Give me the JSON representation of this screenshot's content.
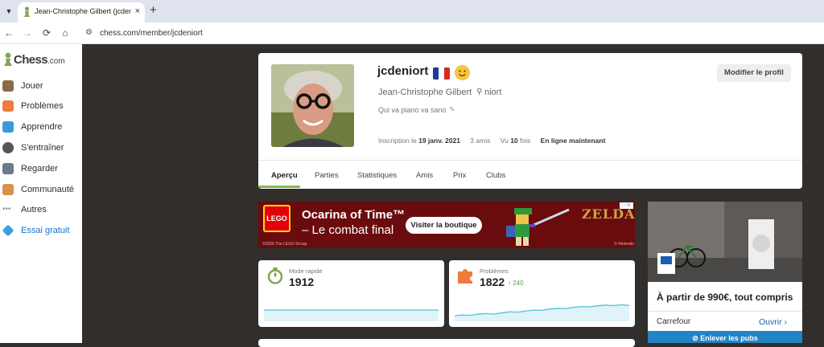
{
  "browser": {
    "tab_title": "Jean-Christophe Gilbert (jcdeniort)",
    "tab_close": "×",
    "new_tab": "+",
    "tab_list_icon": "chevron-down-icon",
    "url": "chess.com/member/jcdeniort",
    "nav": {
      "back": "←",
      "forward": "→",
      "reload": "⟳",
      "home": "⌂"
    }
  },
  "sidebar": {
    "logo_text": "Chess",
    "logo_suffix": ".com",
    "items": [
      {
        "label": "Jouer",
        "icon": "play-pieces-icon",
        "color": "#8a6a4a"
      },
      {
        "label": "Problèmes",
        "icon": "puzzle-icon",
        "color": "#f07b3f"
      },
      {
        "label": "Apprendre",
        "icon": "graduation-cap-icon",
        "color": "#3a9ad9"
      },
      {
        "label": "S'entraîner",
        "icon": "practice-icon",
        "color": "#555555"
      },
      {
        "label": "Regarder",
        "icon": "binoculars-icon",
        "color": "#6c7a8a"
      },
      {
        "label": "Communauté",
        "icon": "community-icon",
        "color": "#d9914a"
      },
      {
        "label": "Autres",
        "icon": "more-dots-icon",
        "color": "#999999"
      },
      {
        "label": "Essai gratuit",
        "icon": "diamond-icon",
        "color": "#36a3e0"
      }
    ]
  },
  "profile": {
    "username": "jcdeniort",
    "full_name": "Jean-Christophe Gilbert",
    "location": "niort",
    "bio": "Qui va piano va sano",
    "joined_label": "Inscription le",
    "joined_date": "19 janv. 2021",
    "friends_count": "3",
    "friends_label": "amis",
    "views_prefix": "Vu",
    "views_count": "10",
    "views_suffix": "fois",
    "online_status": "En ligne maintenant",
    "edit_button": "Modifier le profil",
    "tabs": [
      "Aperçu",
      "Parties",
      "Statistiques",
      "Amis",
      "Prix",
      "Clubs"
    ],
    "active_tab": "Aperçu"
  },
  "ad_banner": {
    "brand": "LEGO",
    "title": "Ocarina of Time™",
    "subtitle": "– Le combat final",
    "cta": "Visiter la boutique",
    "logo_text": "ZELDA",
    "copyright": "©2025 The LEGO Group",
    "partner": "© Nintendo"
  },
  "ratings": [
    {
      "label": "Mode rapide",
      "value": "1912",
      "icon": "stopwatch-icon",
      "trend": [
        0.5,
        0.5,
        0.5,
        0.5,
        0.5,
        0.5,
        0.5,
        0.5,
        0.5,
        0.5
      ]
    },
    {
      "label": "Problèmes",
      "value": "1822",
      "delta": "240",
      "icon": "puzzle-icon",
      "trend": [
        0.18,
        0.22,
        0.2,
        0.28,
        0.3,
        0.27,
        0.35,
        0.4,
        0.38,
        0.45,
        0.5,
        0.48,
        0.56,
        0.6,
        0.58,
        0.66,
        0.7,
        0.68,
        0.74,
        0.78,
        0.75,
        0.8,
        0.76
      ]
    }
  ],
  "side_ad": {
    "headline": "À partir de 990€, tout compris",
    "brand": "Carrefour",
    "open_label": "Ouvrir",
    "remove_label": "Enlever les pubs"
  },
  "colors": {
    "accent_green": "#81b64c",
    "page_bg": "#312e2b",
    "link_blue": "#1a73c9",
    "chart_line": "#4fc3d9",
    "chart_fill": "#dff3f8"
  }
}
